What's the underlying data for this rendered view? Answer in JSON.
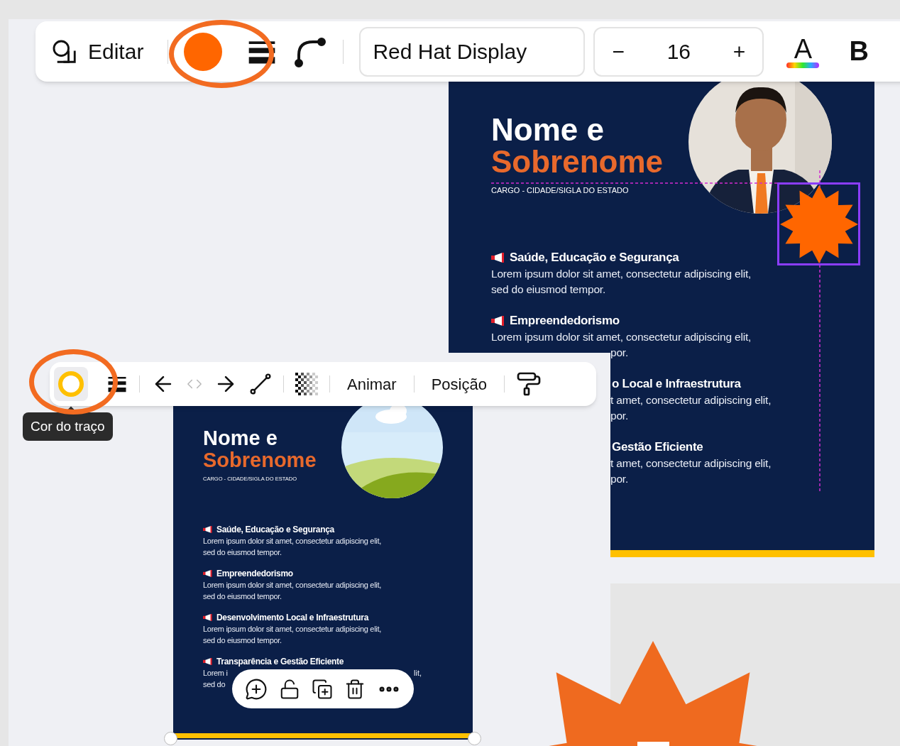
{
  "top_toolbar": {
    "edit_label": "Editar",
    "color_button": {
      "color": "#ff6600"
    },
    "font": "Red Hat Display",
    "size": {
      "minus": "−",
      "value": "16",
      "plus": "+"
    },
    "text_color_label": "A",
    "bold_label": "B"
  },
  "main_poster": {
    "name_line_1": "Nome e",
    "name_line_2": "Sobrenome",
    "subtitle": "CARGO - CIDADE/SIGLA DO ESTADO",
    "sections": [
      {
        "title": "Saúde, Educação e Segurança",
        "kind": "full",
        "lines": [
          {
            "text": "Lorem ipsum dolor sit amet, consectetur adipiscing elit,",
            "kind": "full"
          },
          {
            "text": "sed do eiusmod tempor.",
            "kind": "full"
          }
        ]
      },
      {
        "title": "Empreendedorismo",
        "kind": "full",
        "lines": [
          {
            "text": "Lorem ipsum dolor sit amet, consectetur adipiscing elit,",
            "kind": "full"
          },
          {
            "text": "por.",
            "kind": "fragment"
          }
        ]
      },
      {
        "title": "o Local e Infraestrutura",
        "kind": "fragment",
        "lines": [
          {
            "text": "t amet, consectetur adipiscing elit,",
            "kind": "fragment"
          },
          {
            "text": "por.",
            "kind": "fragment"
          }
        ]
      },
      {
        "title": "Gestão Eficiente",
        "kind": "fragment",
        "lines": [
          {
            "text": "t amet, consectetur adipiscing elit,",
            "kind": "fragment"
          },
          {
            "text": "por.",
            "kind": "fragment"
          }
        ]
      }
    ]
  },
  "element_toolbar": {
    "color_button": {
      "color": "#ffc000",
      "selected": true
    },
    "tooltip": "Cor do traço",
    "buttons": [
      "Animar",
      "Posição"
    ]
  },
  "small_poster": {
    "name_line_1": "Nome e",
    "name_line_2": "Sobrenome",
    "subtitle": "CARGO - CIDADE/SIGLA DO ESTADO",
    "sections": [
      {
        "title": "Saúde, Educação e Segurança",
        "lines": [
          {
            "text": "Lorem ipsum dolor sit amet, consectetur adipiscing elit,"
          },
          {
            "text": "sed do eiusmod tempor."
          }
        ]
      },
      {
        "title": "Empreendedorismo",
        "lines": [
          {
            "text": "Lorem ipsum dolor sit amet, consectetur adipiscing elit,"
          },
          {
            "text": "sed do eiusmod tempor."
          }
        ]
      },
      {
        "title": "Desenvolvimento Local e Infraestrutura",
        "lines": [
          {
            "text": "Lorem ipsum dolor sit amet, consectetur adipiscing elit,"
          },
          {
            "text": "sed do eiusmod tempor."
          }
        ]
      },
      {
        "title": "Transparência e Gestão Eficiente",
        "lines": [
          {
            "text": "Lorem i",
            "right": "lit,"
          },
          {
            "text": "sed do"
          }
        ]
      }
    ]
  }
}
